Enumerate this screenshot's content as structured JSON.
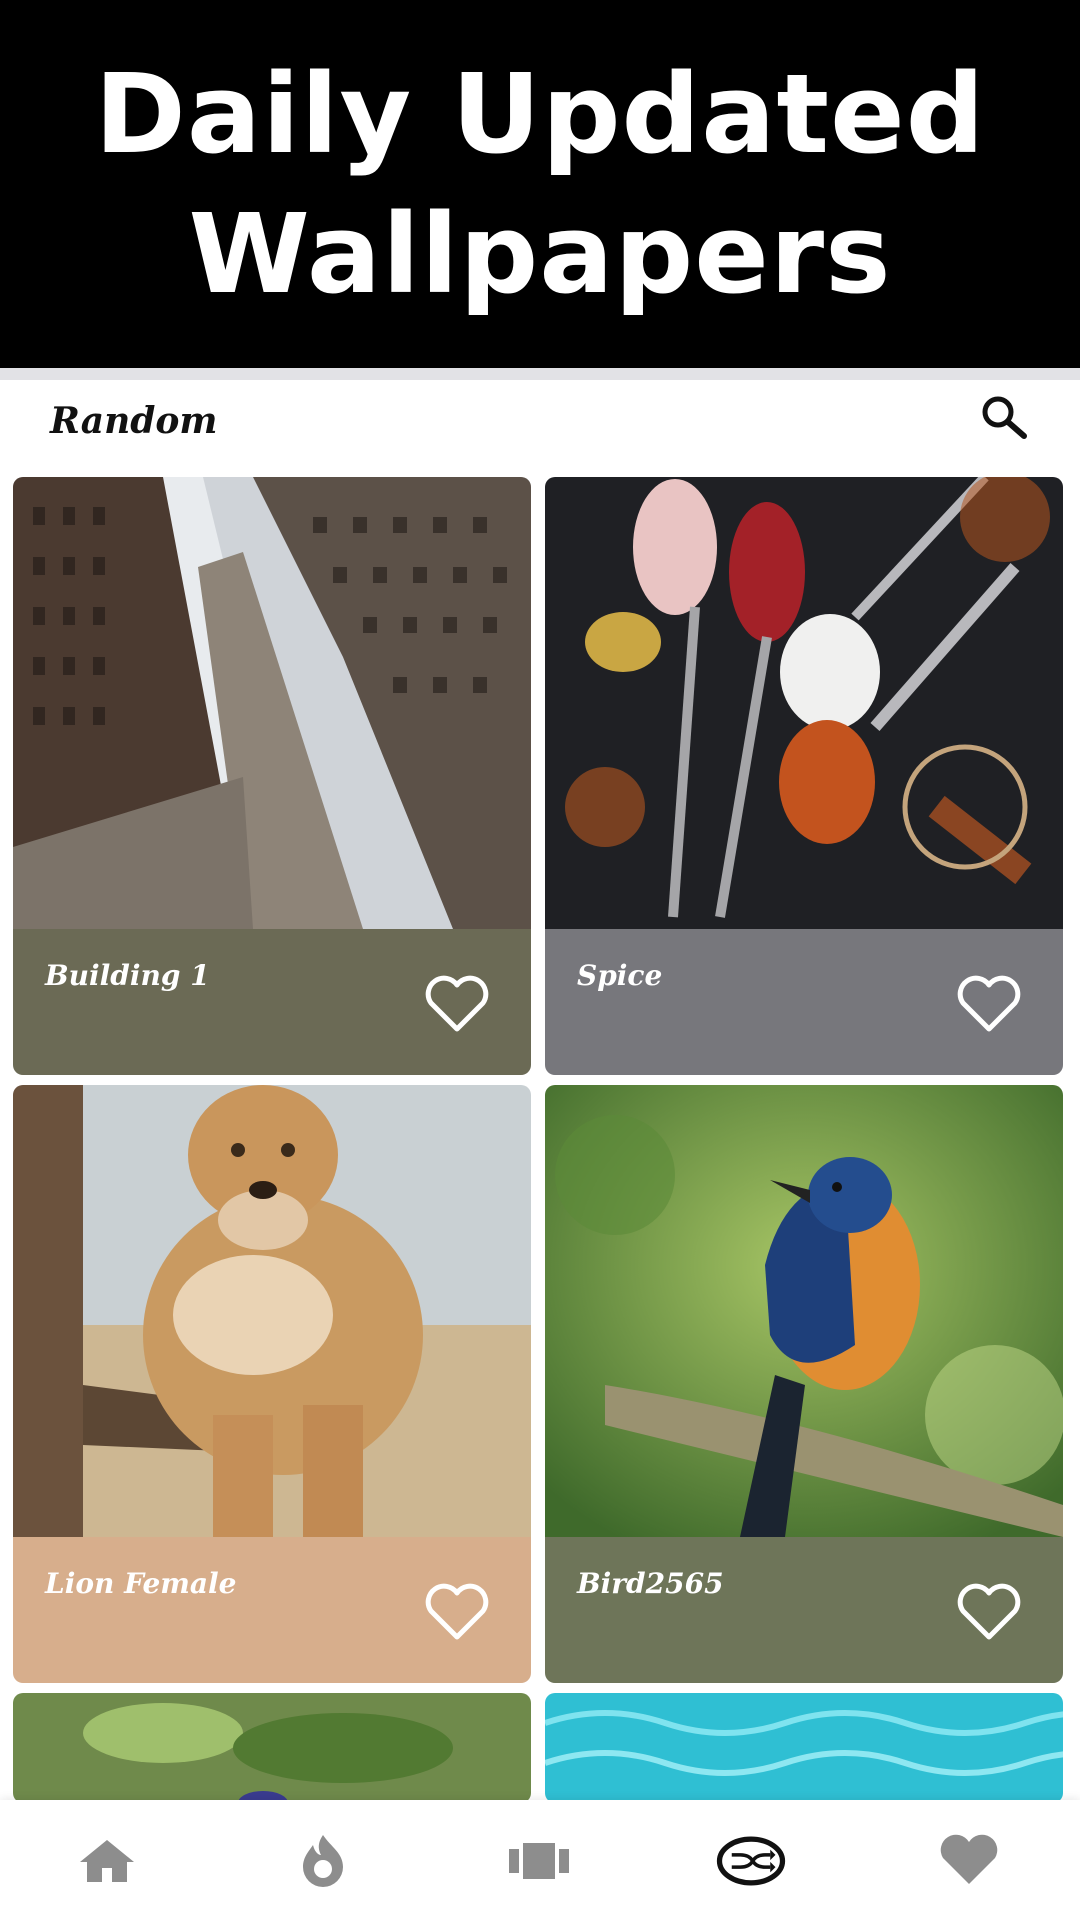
{
  "banner": {
    "line1": "Daily Updated",
    "line2": "Wallpapers"
  },
  "appbar": {
    "title": "Random",
    "search_icon": "search-icon"
  },
  "cards": [
    {
      "title": "Building 1",
      "footer_color": "#6b6a55",
      "icon": "heart-outline-icon"
    },
    {
      "title": "Spice",
      "footer_color": "#77777c",
      "icon": "heart-outline-icon"
    },
    {
      "title": "Lion Female",
      "footer_color": "#d7ae8c",
      "icon": "heart-outline-icon"
    },
    {
      "title": "Bird2565",
      "footer_color": "#6e7559",
      "icon": "heart-outline-icon"
    }
  ],
  "bottom_nav": [
    {
      "name": "home",
      "icon": "home-icon",
      "active": false
    },
    {
      "name": "trending",
      "icon": "flame-icon",
      "active": false
    },
    {
      "name": "categories",
      "icon": "categories-icon",
      "active": false
    },
    {
      "name": "random",
      "icon": "shuffle-icon",
      "active": true
    },
    {
      "name": "favorites",
      "icon": "heart-icon",
      "active": false
    }
  ],
  "colors": {
    "nav_inactive": "#8d8d8d",
    "nav_active": "#111111",
    "banner_bg": "#000000"
  }
}
